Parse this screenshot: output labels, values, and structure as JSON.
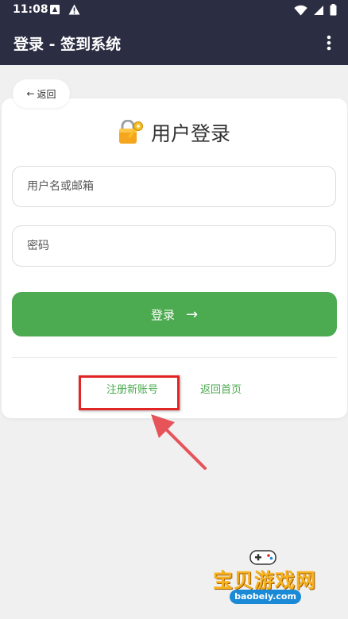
{
  "status_bar": {
    "time": "11:08",
    "left_icons": [
      "app-notification-icon",
      "warning-icon"
    ],
    "right_icons": [
      "wifi-icon",
      "signal-icon",
      "battery-icon"
    ]
  },
  "app_bar": {
    "title": "登录 - 签到系统",
    "menu_icon": "more-vert-icon"
  },
  "back_button": {
    "arrow": "←",
    "label": "返回"
  },
  "login_card": {
    "icon": "lock-key-icon",
    "title": "用户登录",
    "username_placeholder": "用户名或邮箱",
    "password_placeholder": "密码",
    "login_label": "登录",
    "login_arrow": "→",
    "register_link": "注册新账号",
    "home_link": "返回首页"
  },
  "watermark": {
    "text": "宝贝游戏网",
    "url": "baobeiy.com"
  },
  "colors": {
    "app_bar": "#2b2d42",
    "accent_green": "#4caa50",
    "annotation_red": "#e32424",
    "background": "#f0f0f0"
  }
}
